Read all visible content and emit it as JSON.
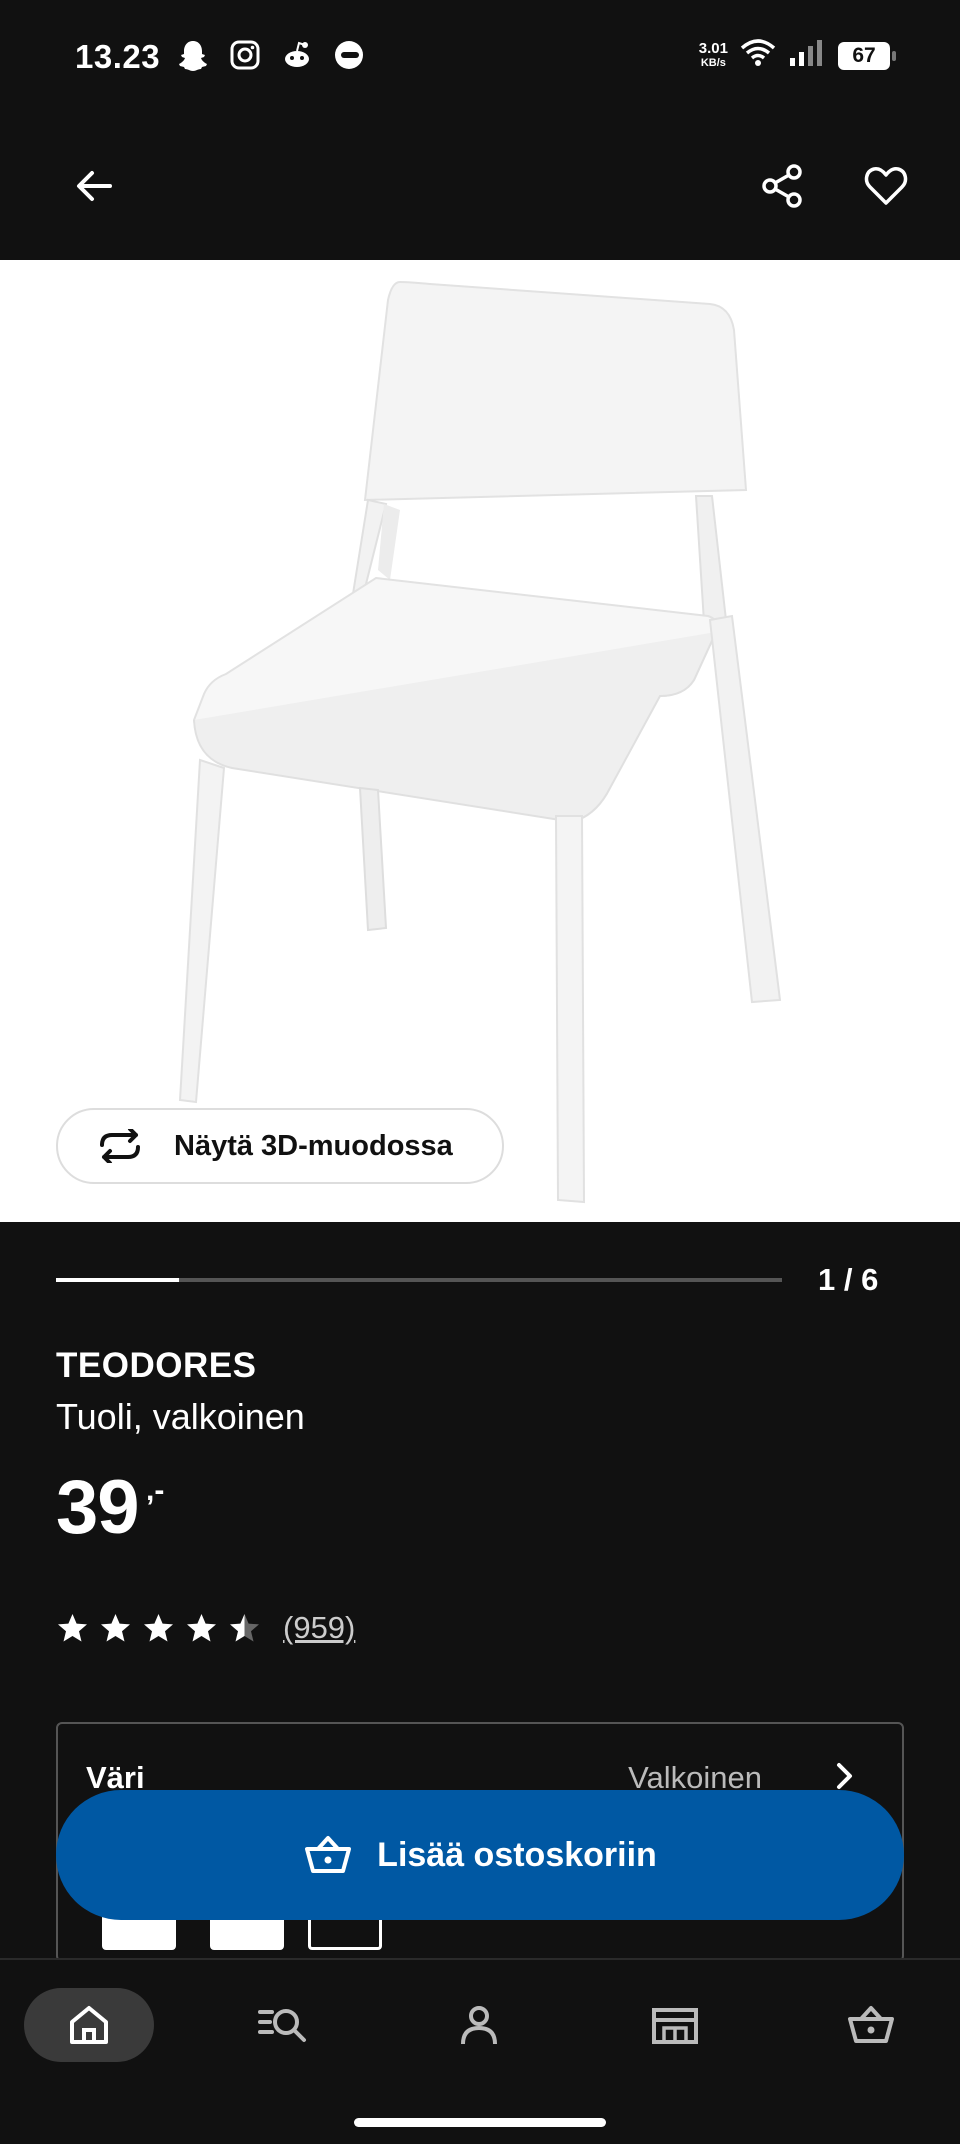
{
  "status_bar": {
    "time": "13.23",
    "net_speed_value": "3.01",
    "net_speed_unit": "KB/s",
    "battery": "67",
    "app_icons": [
      "snapchat-icon",
      "instagram-icon",
      "reddit-icon",
      "app-icon"
    ]
  },
  "hero": {
    "view_3d_label": "Näytä 3D-muodossa"
  },
  "gallery": {
    "pager": "1 / 6",
    "progress_fraction": 0.17
  },
  "product": {
    "name": "TEODORES",
    "description": "Tuoli, valkoinen",
    "price": "39",
    "price_suffix": ",-",
    "rating": 4.5,
    "reviews": "(959)"
  },
  "variant": {
    "label": "Väri",
    "value": "Valkoinen"
  },
  "cta": {
    "label": "Lisää ostoskoriin"
  },
  "bottom_nav": {
    "items": [
      "home-icon",
      "search-products-icon",
      "account-icon",
      "store-icon",
      "cart-icon"
    ],
    "active_index": 0
  },
  "colors": {
    "background": "#111111",
    "accent_blue": "#0058a3"
  }
}
